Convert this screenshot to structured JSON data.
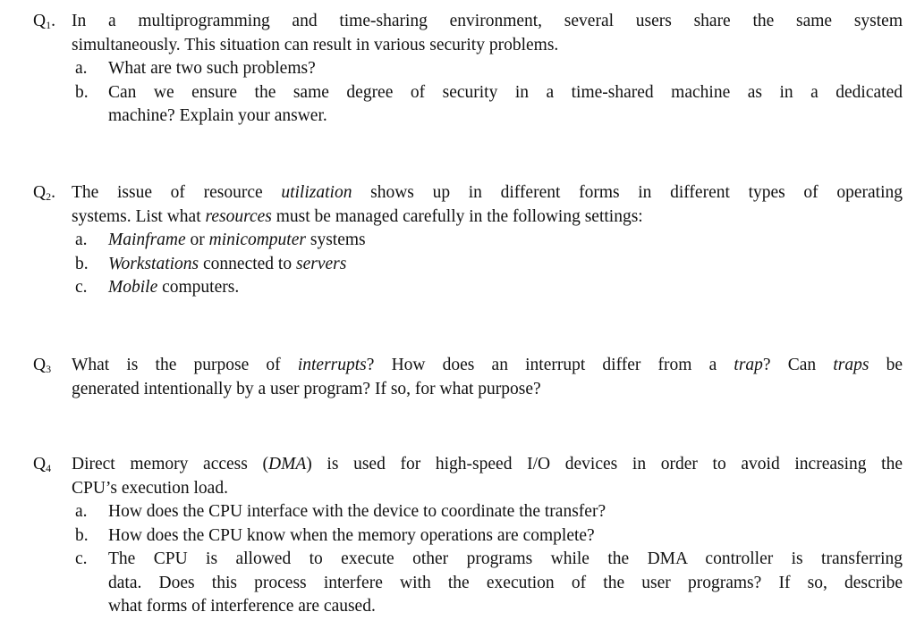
{
  "questions": [
    {
      "label": "Q",
      "num": "1",
      "suffix": ".",
      "lines": [
        "In a multiprogramming and time-sharing environment, several users share the same system",
        "simultaneously. This situation can result in various security problems."
      ],
      "items": [
        {
          "label": "a.",
          "lines": [
            "What are two such problems?"
          ]
        },
        {
          "label": "b.",
          "lines": [
            "Can we ensure the same degree of security in a time-shared machine as in a dedicated",
            "machine? Explain your answer."
          ]
        }
      ]
    },
    {
      "label": "Q",
      "num": "2",
      "suffix": ".",
      "line1": {
        "t1": "The issue of resource ",
        "i1": "utilization",
        "t2": " shows up in different forms in different types of operating"
      },
      "line2": {
        "t1": "systems. List what ",
        "i1": "resources",
        "t2": " must be managed carefully in the following settings:"
      },
      "items": [
        {
          "label": "a.",
          "i1": "Mainframe",
          "t1": " or ",
          "i2": "minicomputer",
          "t2": " systems"
        },
        {
          "label": "b.",
          "i1": "Workstations",
          "t1": " connected to ",
          "i2": "servers",
          "t2": ""
        },
        {
          "label": "c.",
          "i1": "Mobile",
          "t1": " computers.",
          "i2": "",
          "t2": ""
        }
      ]
    },
    {
      "label": "Q",
      "num": "3",
      "suffix": "",
      "line1": {
        "t1": "What is the purpose of ",
        "i1": "interrupts",
        "t2": "? How does an interrupt differ from a ",
        "i2": "trap",
        "t3": "? Can ",
        "i3": "traps",
        "t4": " be"
      },
      "line2": "generated intentionally by a user program? If so, for what purpose?"
    },
    {
      "label": "Q",
      "num": "4",
      "suffix": "",
      "line1": {
        "t1": "Direct memory access (",
        "i1": "DMA",
        "t2": ") is used for high-speed I/O devices in order to avoid increasing the"
      },
      "line2": "CPU’s execution load.",
      "items": [
        {
          "label": "a.",
          "lines": [
            "How does the CPU interface with the device to coordinate the transfer?"
          ]
        },
        {
          "label": "b.",
          "lines": [
            "How does the CPU know when the memory operations are complete?"
          ]
        },
        {
          "label": "c.",
          "lines": [
            "The CPU is allowed to execute other programs while the DMA controller is transferring",
            "data. Does this process interfere with the execution of the user programs? If so, describe",
            "what forms of interference are caused."
          ]
        }
      ]
    }
  ]
}
